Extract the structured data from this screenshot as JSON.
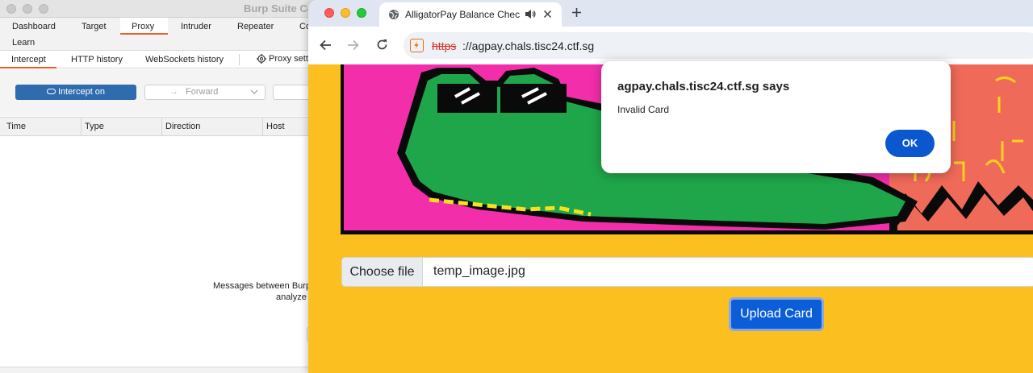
{
  "burp": {
    "title": "Burp Suite Co",
    "tabs": [
      "Dashboard",
      "Target",
      "Proxy",
      "Intruder",
      "Repeater",
      "Co"
    ],
    "tabs_row2": [
      "Learn"
    ],
    "sub_tabs": [
      "Intercept",
      "HTTP history",
      "WebSockets history",
      "Proxy setti"
    ],
    "intercept_button": "Intercept on",
    "forward_button": "Forward",
    "table_columns": [
      "Time",
      "Type",
      "Direction",
      "Host"
    ],
    "message_line1": "Messages between Burp",
    "message_line2": "analyze a"
  },
  "chrome": {
    "tab_title": "AlligatorPay Balance Chec",
    "url_scheme": "https",
    "url_rest": "://agpay.chals.tisc24.ctf.sg"
  },
  "page": {
    "choose_file_label": "Choose file",
    "file_name": "temp_image.jpg",
    "upload_button": "Upload Card"
  },
  "alert": {
    "title": "agpay.chals.tisc24.ctf.sg says",
    "message": "Invalid Card",
    "ok_label": "OK"
  },
  "colors": {
    "page_background": "#fbc01f",
    "upload_button": "#0b5ed7",
    "alert_ok": "#0b57d0",
    "burp_accent": "#e8612c",
    "burp_intercept": "#2f6cad"
  }
}
